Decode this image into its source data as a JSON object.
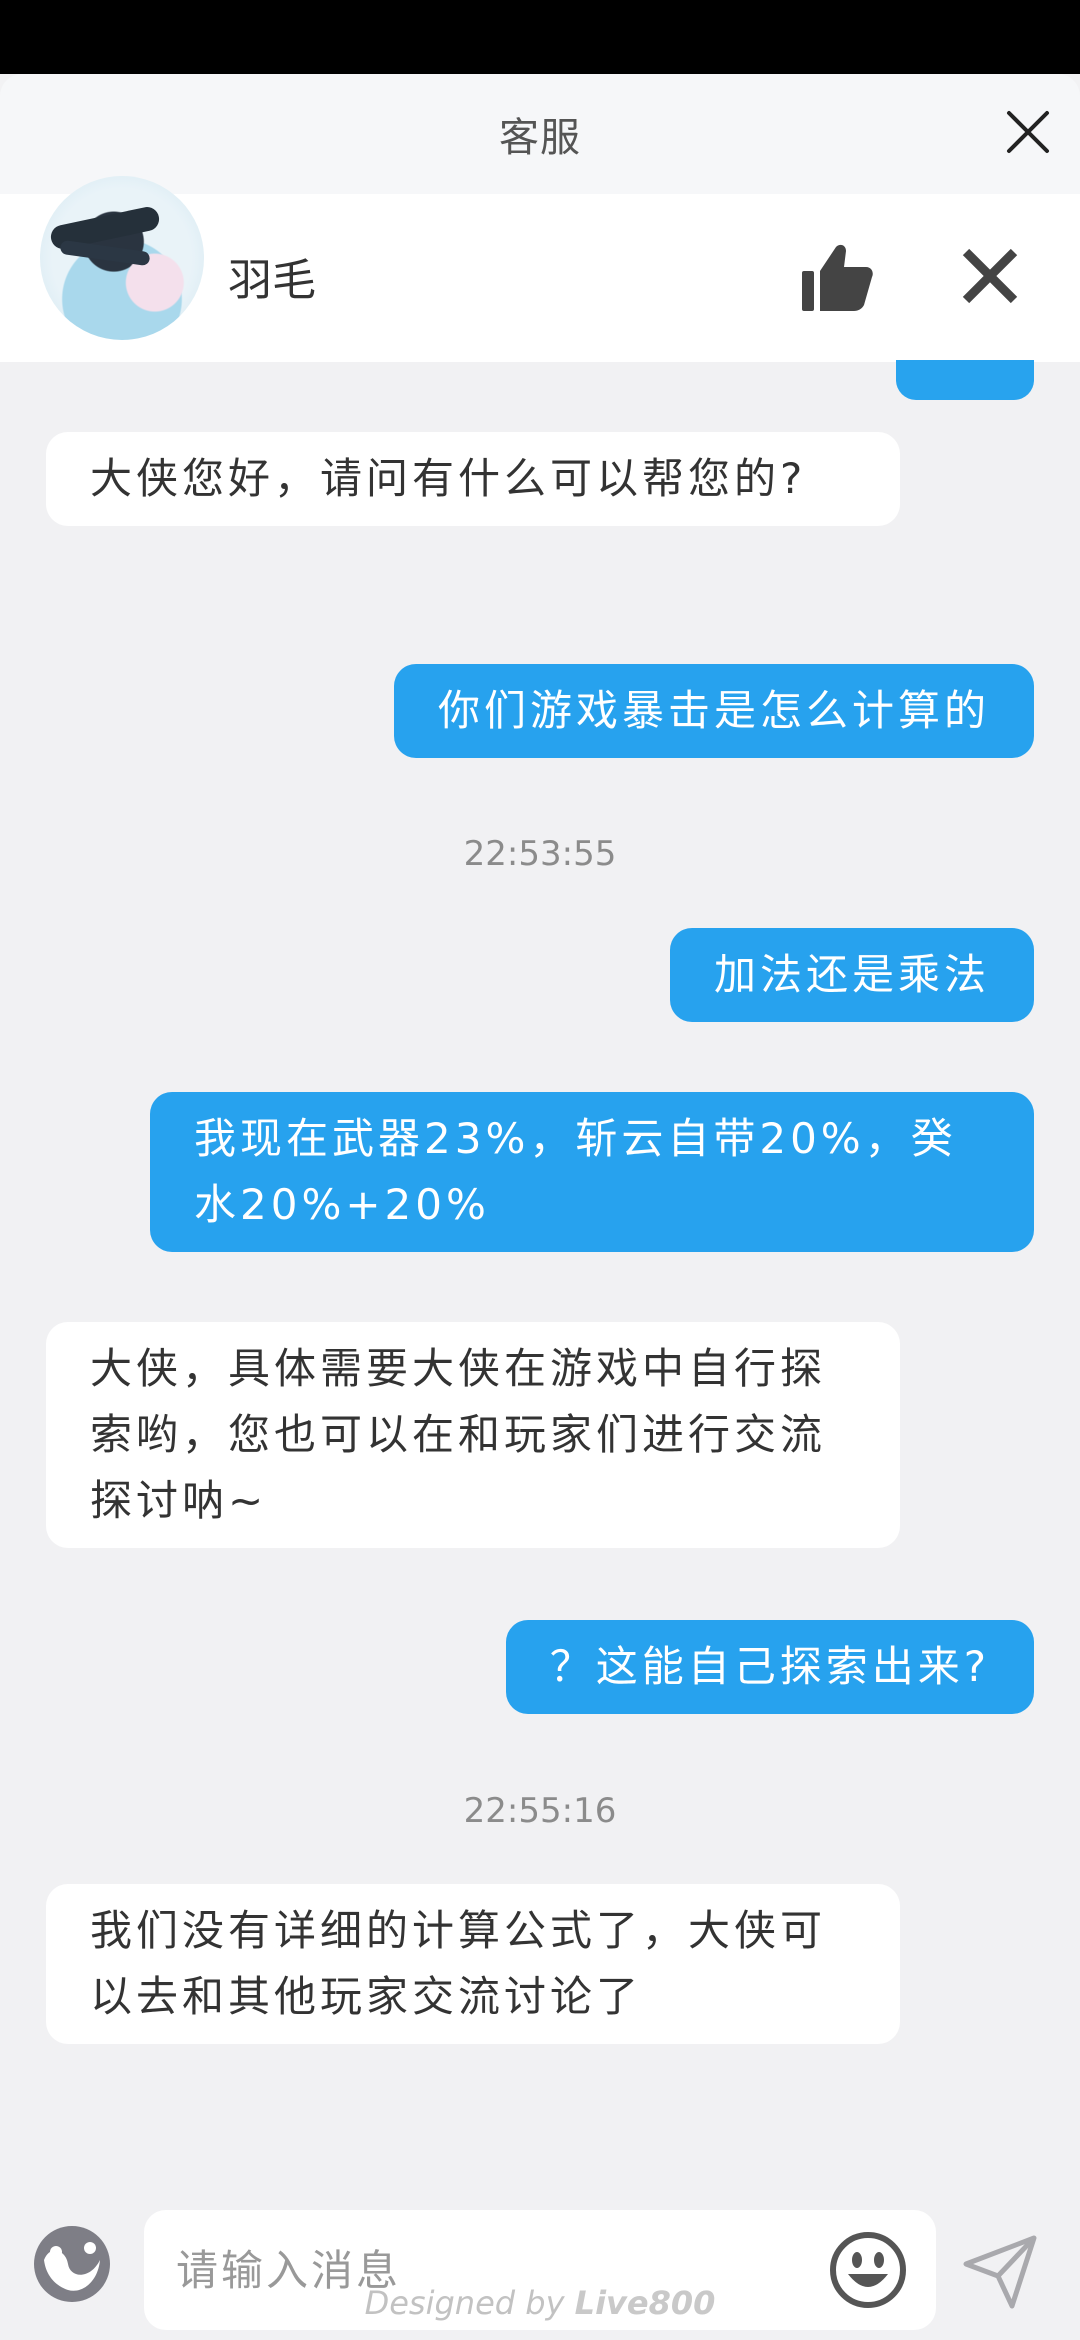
{
  "window": {
    "title": "客服"
  },
  "agent": {
    "name": "羽毛"
  },
  "messages": [
    {
      "side": "agent",
      "text": "大侠您好，请问有什么可以帮您的?"
    },
    {
      "side": "user",
      "text": "你们游戏暴击是怎么计算的"
    },
    {
      "side": "time",
      "text": "22:53:55"
    },
    {
      "side": "user",
      "text": "加法还是乘法"
    },
    {
      "side": "user",
      "text": "我现在武器23%，斩云自带20%，癸水20%+20%"
    },
    {
      "side": "agent",
      "text": "大侠，具体需要大侠在游戏中自行探索哟，您也可以在和玩家们进行交流探讨呐~"
    },
    {
      "side": "user",
      "text": "？这能自己探索出来?"
    },
    {
      "side": "time",
      "text": "22:55:16"
    },
    {
      "side": "agent",
      "text": "我们没有详细的计算公式了，大侠可以去和其他玩家交流讨论了"
    }
  ],
  "input": {
    "placeholder": "请输入消息"
  },
  "footer": {
    "prefix": "Designed by",
    "brand": "Live800"
  },
  "colors": {
    "user_bubble": "#27a2ee",
    "agent_bubble": "#ffffff",
    "background": "#f1f1f3"
  },
  "icons": [
    "close-icon",
    "thumbs-up-icon",
    "close-icon",
    "emoji-icon",
    "smile-icon",
    "send-icon"
  ]
}
